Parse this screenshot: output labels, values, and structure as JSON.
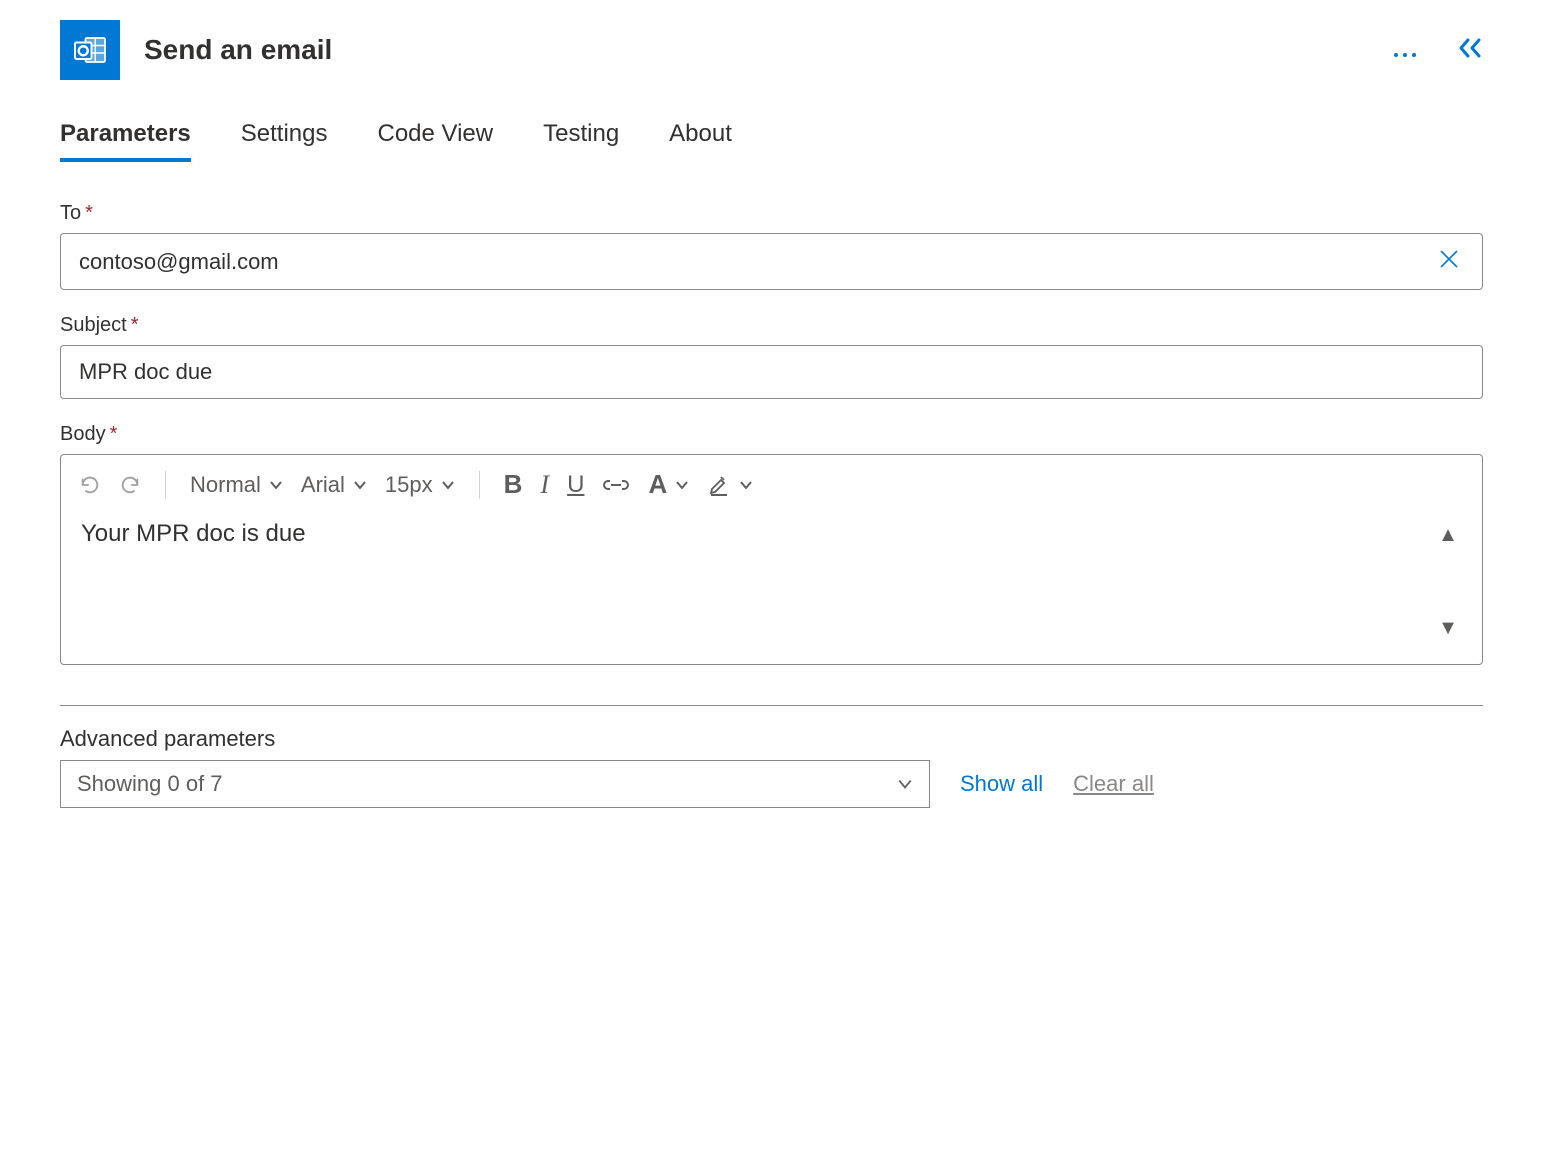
{
  "header": {
    "title": "Send an email"
  },
  "tabs": {
    "items": [
      "Parameters",
      "Settings",
      "Code View",
      "Testing",
      "About"
    ],
    "activeIndex": 0
  },
  "fields": {
    "to": {
      "label": "To",
      "value": "contoso@gmail.com"
    },
    "subject": {
      "label": "Subject",
      "value": "MPR doc due"
    },
    "body": {
      "label": "Body",
      "value": "Your MPR doc is due"
    }
  },
  "toolbar": {
    "blockStyle": "Normal",
    "font": "Arial",
    "size": "15px"
  },
  "advanced": {
    "label": "Advanced parameters",
    "summary": "Showing 0 of 7",
    "showAll": "Show all",
    "clearAll": "Clear all"
  }
}
